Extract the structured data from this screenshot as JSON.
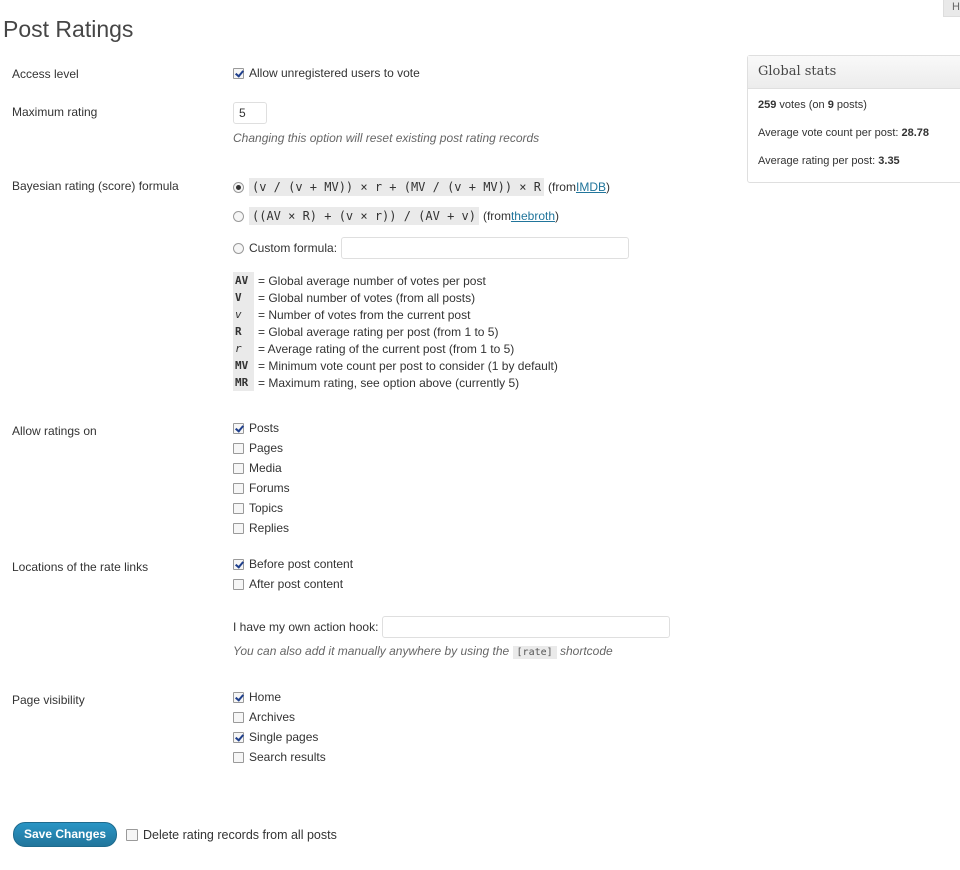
{
  "help_tab": "H",
  "page_title": "Post Ratings",
  "access_level": {
    "label": "Access level",
    "option": "Allow unregistered users to vote",
    "checked": true
  },
  "maximum_rating": {
    "label": "Maximum rating",
    "value": "5",
    "note": "Changing this option will reset existing post rating records"
  },
  "bayesian": {
    "label": "Bayesian rating (score) formula",
    "options": [
      {
        "formula": "(v / (v + MV)) × r + (MV / (v + MV)) × R",
        "from_prefix": "(from ",
        "link": "IMDB",
        "from_suffix": ")",
        "selected": true
      },
      {
        "formula": "((AV × R) + (v × r)) / (AV + v)",
        "from_prefix": "(from ",
        "link": "thebroth",
        "from_suffix": ")",
        "selected": false
      }
    ],
    "custom_label": "Custom formula:",
    "custom_value": "",
    "legend": [
      {
        "key": "AV",
        "text": "= Global average number of votes per post",
        "italic": false
      },
      {
        "key": "V",
        "text": "= Global number of votes (from all posts)",
        "italic": false
      },
      {
        "key": "v",
        "text": "= Number of votes from the current post",
        "italic": true
      },
      {
        "key": "R",
        "text": "= Global average rating per post (from 1 to 5)",
        "italic": false
      },
      {
        "key": "r",
        "text": "= Average rating of the current post (from 1 to 5)",
        "italic": true
      },
      {
        "key": "MV",
        "text": "= Minimum vote count per post to consider (1 by default)",
        "italic": false
      },
      {
        "key": "MR",
        "text": "= Maximum rating, see option above (currently 5)",
        "italic": false
      }
    ]
  },
  "allow_ratings_on": {
    "label": "Allow ratings on",
    "options": [
      {
        "label": "Posts",
        "checked": true
      },
      {
        "label": "Pages",
        "checked": false
      },
      {
        "label": "Media",
        "checked": false
      },
      {
        "label": "Forums",
        "checked": false
      },
      {
        "label": "Topics",
        "checked": false
      },
      {
        "label": "Replies",
        "checked": false
      }
    ]
  },
  "locations": {
    "label": "Locations of the rate links",
    "options": [
      {
        "label": "Before post content",
        "checked": true
      },
      {
        "label": "After post content",
        "checked": false
      }
    ],
    "hook_label": "I have my own action hook:",
    "hook_value": "",
    "note_prefix": "You can also add it manually anywhere by using the",
    "note_code": "[rate]",
    "note_suffix": "shortcode"
  },
  "page_visibility": {
    "label": "Page visibility",
    "options": [
      {
        "label": "Home",
        "checked": true
      },
      {
        "label": "Archives",
        "checked": false
      },
      {
        "label": "Single pages",
        "checked": true
      },
      {
        "label": "Search results",
        "checked": false
      }
    ]
  },
  "global_stats": {
    "title": "Global stats",
    "votes": "259",
    "votes_mid": "votes (on",
    "posts": "9",
    "posts_suffix": "posts)",
    "avg_vote_label": "Average vote count per post:",
    "avg_vote_value": "28.78",
    "avg_rating_label": "Average rating per post:",
    "avg_rating_value": "3.35"
  },
  "footer": {
    "save_label": "Save Changes",
    "delete_label": "Delete rating records from all posts",
    "delete_checked": false
  }
}
